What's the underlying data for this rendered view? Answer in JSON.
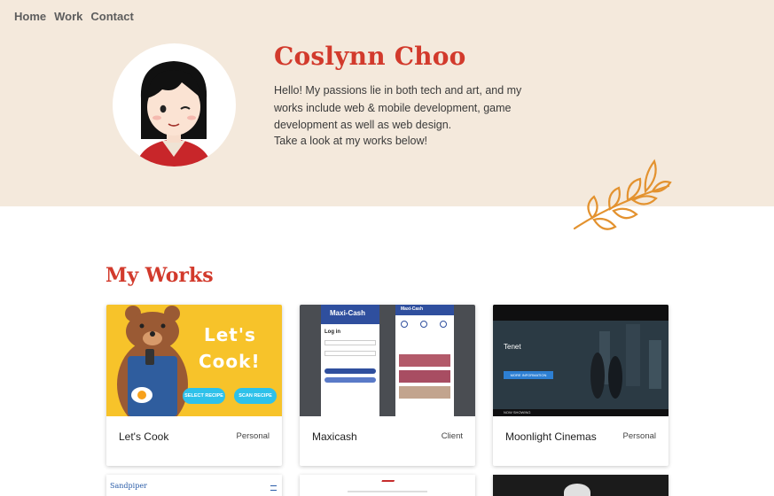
{
  "nav": {
    "items": [
      {
        "label": "Home"
      },
      {
        "label": "Work"
      },
      {
        "label": "Contact"
      }
    ]
  },
  "hero": {
    "name": "Coslynn Choo",
    "bio": "Hello! My passions lie in both tech and art, and my works include web & mobile development, game development as well as web design.",
    "cta": "Take a look at my works below!"
  },
  "works": {
    "title": "My Works",
    "cards": [
      {
        "title": "Let's Cook",
        "tag": "Personal",
        "thumb": {
          "headline1": "Let's",
          "headline2": "Cook!",
          "btn1": "SELECT RECIPE",
          "btn2": "SCAN RECIPE"
        }
      },
      {
        "title": "Maxicash",
        "tag": "Client",
        "thumb": {
          "brand": "Maxi-Cash",
          "login": "Log in",
          "brand2": "Maxi-Cash"
        }
      },
      {
        "title": "Moonlight Cinemas",
        "tag": "Personal",
        "thumb": {
          "film": "Tenet",
          "btn": "MORE INFORMATION",
          "status": "NOW SHOWING"
        }
      }
    ],
    "row2": [
      {
        "brand": "Sandpiper"
      },
      {},
      {}
    ]
  },
  "colors": {
    "accent": "#d23a2c",
    "hero_bg": "#f4e9dc",
    "leaf": "#e3922f"
  }
}
